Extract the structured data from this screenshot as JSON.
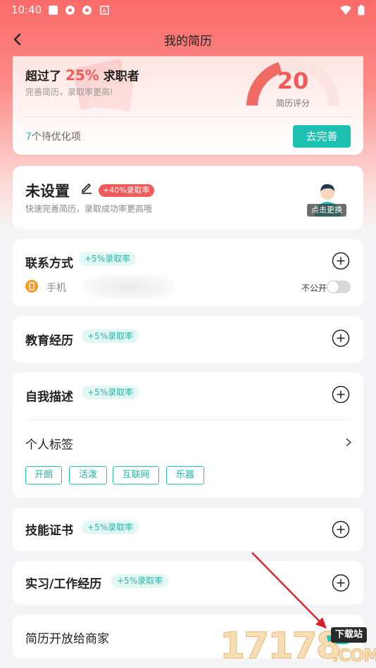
{
  "status_bar": {
    "time": "10:40"
  },
  "nav": {
    "title": "我的简历"
  },
  "score_card": {
    "headline_prefix": "超过了",
    "headline_percent": "25%",
    "headline_suffix": "求职者",
    "subtitle": "完善简历，录取率更高!",
    "score": "20",
    "score_label": "简历评分",
    "todo_count": "7",
    "todo_text": "个待优化项",
    "action_label": "去完善"
  },
  "profile": {
    "name": "未设置",
    "badge": "+40%录取率",
    "subtitle": "快速完善简历，录取成功率更高哦",
    "avatar_tag": "点击更换"
  },
  "contact": {
    "title": "联系方式",
    "badge": "+5%录取率",
    "phone_label": "手机",
    "private_label": "不公开"
  },
  "education": {
    "title": "教育经历",
    "badge": "+5%录取率"
  },
  "self_desc": {
    "title": "自我描述",
    "badge": "+5%录取率",
    "tags_title": "个人标签",
    "tags": [
      "开朗",
      "活泼",
      "互联网",
      "乐器"
    ]
  },
  "certificates": {
    "title": "技能证书",
    "badge": "+5%录取率"
  },
  "internship": {
    "title": "实习/工作经历",
    "badge": "+5%录取率"
  },
  "open_to_business": {
    "title": "简历开放给商家",
    "enabled": true
  },
  "watermark": {
    "number": "17178",
    "tag": "下载站",
    "domain": ".COM"
  },
  "colors": {
    "accent": "#1cc1b2",
    "red": "#f25a5a",
    "header": "#fa6a6a"
  }
}
